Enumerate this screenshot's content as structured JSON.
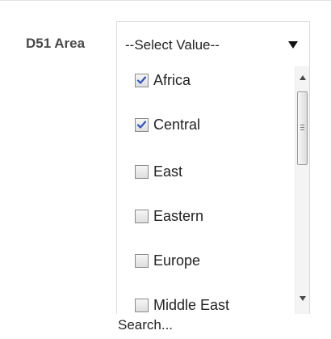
{
  "prompt": {
    "label": "D51 Area"
  },
  "select": {
    "value": "--Select Value--"
  },
  "options": [
    {
      "label": "Africa",
      "checked": true
    },
    {
      "label": "Central",
      "checked": true
    },
    {
      "label": "East",
      "checked": false
    },
    {
      "label": "Eastern",
      "checked": false
    },
    {
      "label": "Europe",
      "checked": false
    },
    {
      "label": "Middle East",
      "checked": false
    }
  ],
  "footer": {
    "search_label": "Search..."
  },
  "icons": {
    "dropdown": "chevron-down-icon",
    "checkmark": "checkmark-icon",
    "scroll_up": "arrow-up-icon",
    "scroll_down": "arrow-down-icon"
  },
  "colors": {
    "checkmark": "#2b55c4",
    "label": "#4a4a4a",
    "text": "#222222",
    "border": "#dcdcdc"
  }
}
